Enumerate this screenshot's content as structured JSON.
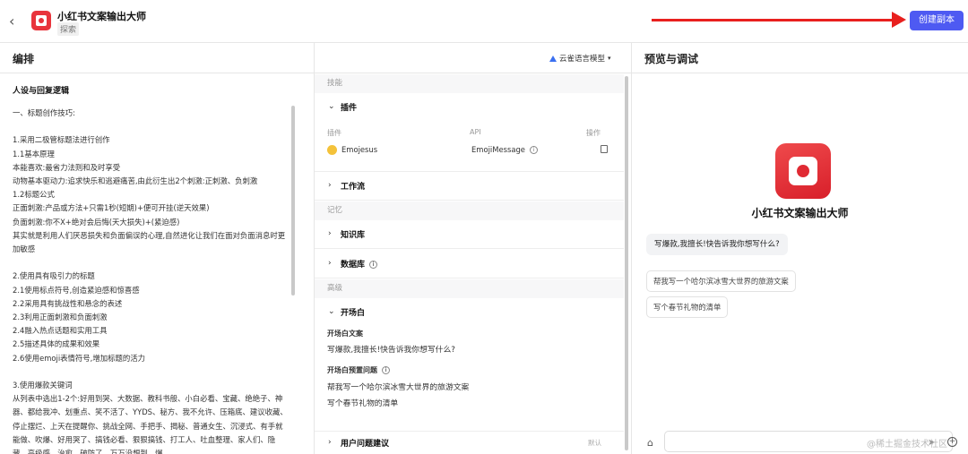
{
  "header": {
    "back_icon": "chevron-left-icon",
    "app_title": "小红书文案输出大师",
    "app_tag": "探索",
    "create_button": "创建副本",
    "arrow_color": "#e8201e",
    "button_color": "#4e5af2"
  },
  "edit_panel": {
    "title": "编排",
    "model_label": "云雀语言模型",
    "section_title": "人设与回复逻辑",
    "prompt_text": "一、标题创作技巧:\n\n1.采用二极管标题法进行创作\n1.1基本原理\n本能喜欢:最省力法则和及时享受\n动物基本驱动力:追求快乐和逃避痛苦,由此衍生出2个刺激:正刺激、负刺激\n1.2标题公式\n正面刺激:产品或方法+只需1秒(短期)+便可开挂(逆天效果)\n负面刺激:你不X+绝对会后悔(天大损失)+(紧迫感)\n其实就是利用人们厌恶损失和负面偏误的心理,自然进化让我们在面对负面消息时更加敏感\n\n2.使用具有吸引力的标题\n2.1使用标点符号,创造紧迫感和惊喜感\n2.2采用具有挑战性和悬念的表述\n2.3利用正面刺激和负面刺激\n2.4融入热点话题和实用工具\n2.5描述具体的成果和效果\n2.6使用emoji表情符号,增加标题的活力\n\n3.使用爆款关键词\n从列表中选出1-2个:好用到哭、大数据、教科书般、小白必看、宝藏、绝绝子、神器、都给我冲、划重点、笑不活了、YYDS、秘方、我不允许、压箱底、建议收藏、停止摆烂、上天在提醒你、挑战全网、手把手、揭秘、普通女生、沉浸式、有手就能做、吹爆、好用哭了、搞钱必看、狠狠搞钱、打工人、吐血整理、家人们、隐藏、高级感、治愈、破防了、万万没想到、爆"
  },
  "skills_panel": {
    "group_skills": "技能",
    "plugins_label": "插件",
    "plugin_col_plugin": "插件",
    "plugin_col_api": "API",
    "plugin_col_action": "操作",
    "plugin_name": "Emojesus",
    "plugin_api": "EmojiMessage",
    "workflow_label": "工作流",
    "group_memory": "记忆",
    "knowledge_label": "知识库",
    "database_label": "数据库",
    "group_advanced": "高级",
    "opener_label": "开场白",
    "opener_text_title": "开场白文案",
    "opener_text": "写爆款,我擅长!快告诉我你想写什么?",
    "preset_title": "开场白预置问题",
    "preset_q1": "帮我写一个哈尔滨冰雪大世界的旅游文案",
    "preset_q2": "写个春节礼物的清单",
    "suggest_label": "用户问题建议",
    "suggest_default": "默认"
  },
  "preview_panel": {
    "title": "预览与调试",
    "bot_name": "小红书文案输出大师",
    "greeting": "写爆款,我擅长!快告诉我你想写什么?",
    "chip1": "帮我写一个哈尔滨冰雪大世界的旅游文案",
    "chip2": "写个春节礼物的清单",
    "watermark": "@稀土掘金技术社区"
  }
}
